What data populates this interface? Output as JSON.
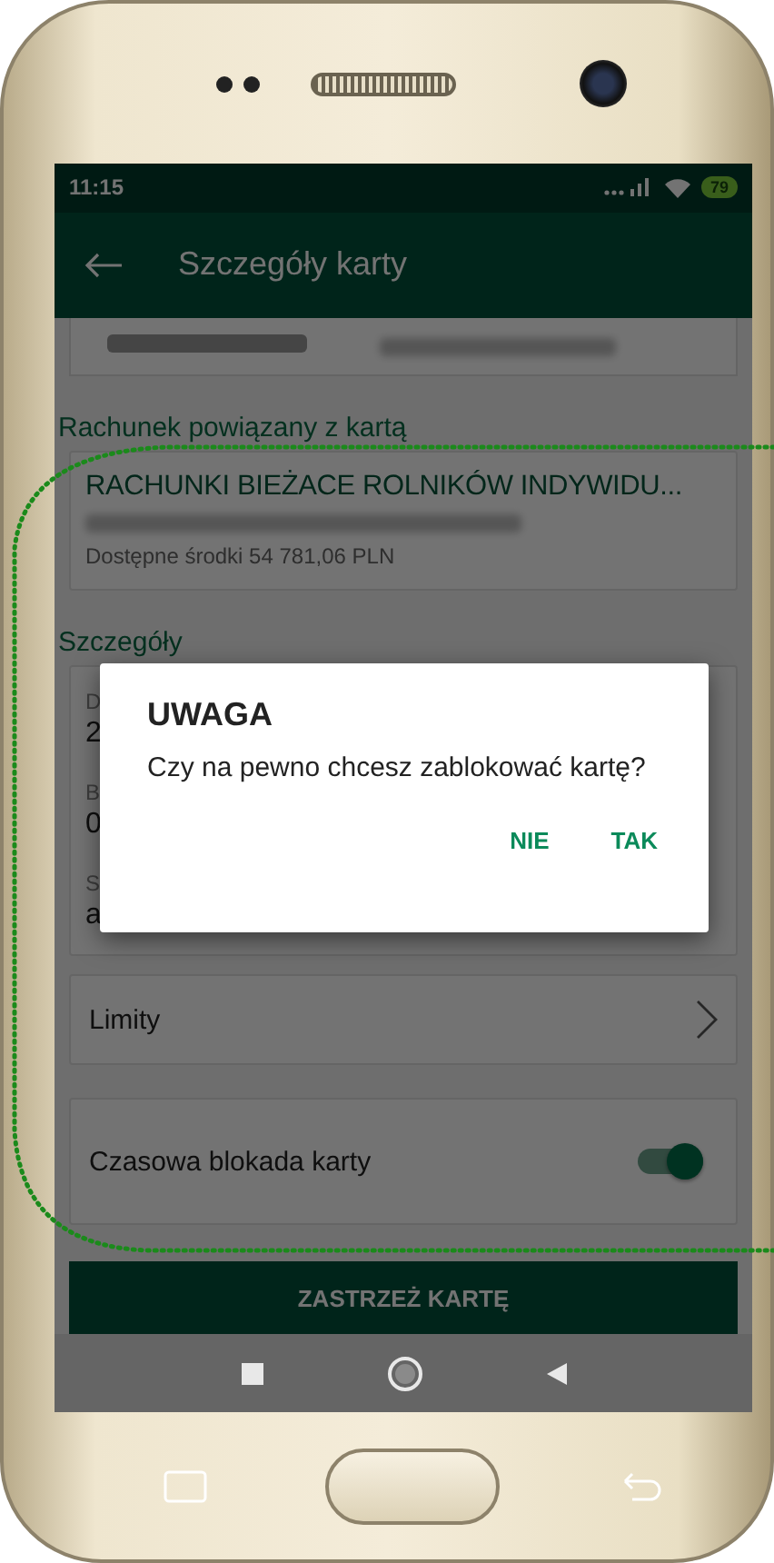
{
  "status_bar": {
    "time": "11:15",
    "battery": "79"
  },
  "app_bar": {
    "title": "Szczegóły karty"
  },
  "account_section": {
    "heading": "Rachunek powiązany z kartą",
    "name": "RACHUNKI BIEŻACE ROLNIKÓW INDYWIDU...",
    "funds": "Dostępne środki 54 781,06 PLN"
  },
  "details_section": {
    "heading": "Szczegóły",
    "fields": [
      {
        "label": "D",
        "value": "2"
      },
      {
        "label": "B",
        "value": "0"
      },
      {
        "label": "S",
        "value": "a"
      }
    ]
  },
  "limits": {
    "label": "Limity"
  },
  "temp_block": {
    "label": "Czasowa blokada karty",
    "on": true
  },
  "main_button": "ZASTRZEŻ KARTĘ",
  "dialog": {
    "title": "UWAGA",
    "message": "Czy na pewno chcesz zablokować kartę?",
    "buttons": [
      "NIE",
      "TAK"
    ]
  }
}
